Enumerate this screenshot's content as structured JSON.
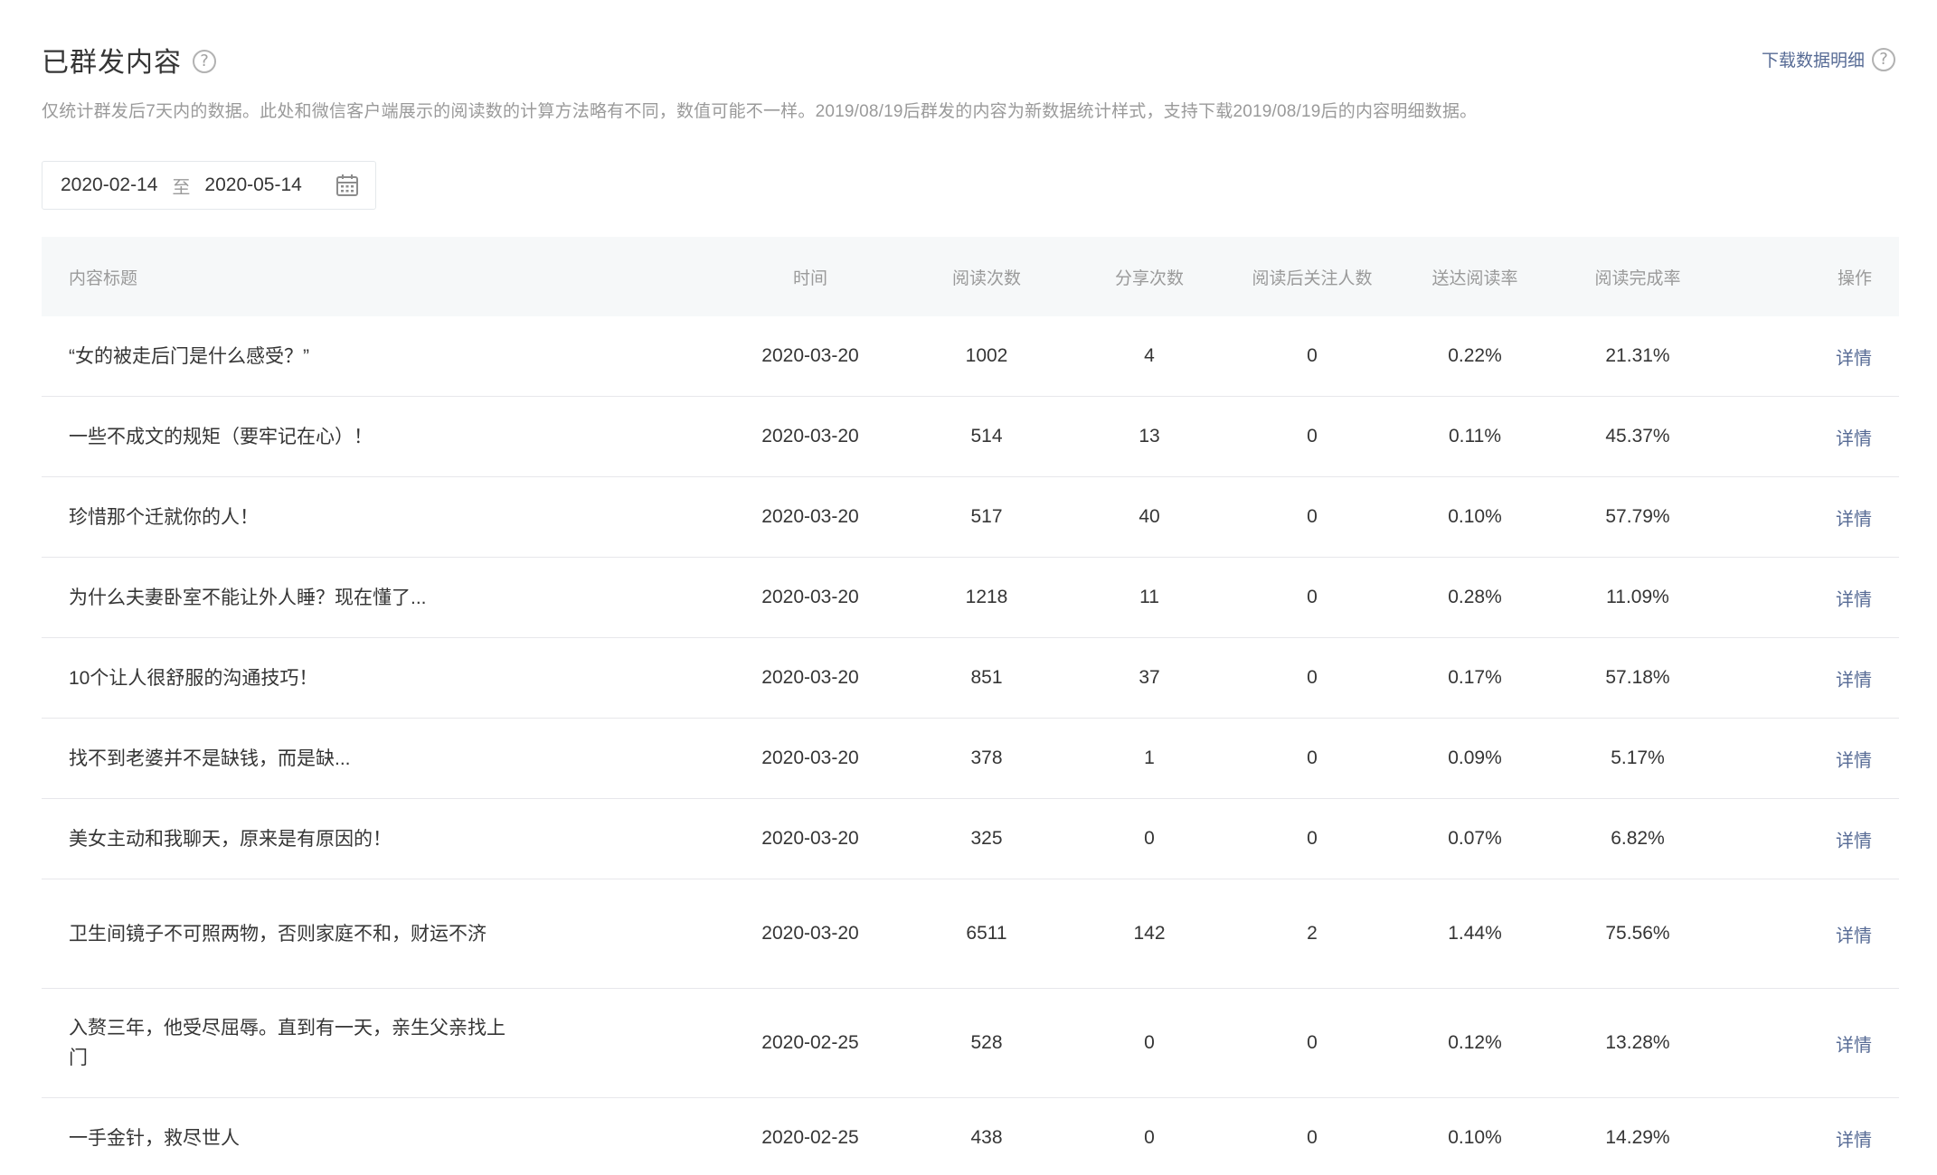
{
  "header": {
    "title": "已群发内容",
    "download_label": "下载数据明细",
    "description": "仅统计群发后7天内的数据。此处和微信客户端展示的阅读数的计算方法略有不同，数值可能不一样。2019/08/19后群发的内容为新数据统计样式，支持下载2019/08/19后的内容明细数据。"
  },
  "date_range": {
    "start": "2020-02-14",
    "separator": "至",
    "end": "2020-05-14"
  },
  "table": {
    "columns": {
      "title": "内容标题",
      "time": "时间",
      "reads": "阅读次数",
      "shares": "分享次数",
      "follows": "阅读后关注人数",
      "delivery_rate": "送达阅读率",
      "completion_rate": "阅读完成率",
      "action": "操作"
    },
    "rows": [
      {
        "title": "“女的被走后门是什么感受？”",
        "time": "2020-03-20",
        "reads": "1002",
        "shares": "4",
        "follows": "0",
        "delivery_rate": "0.22%",
        "completion_rate": "21.31%",
        "action": "详情"
      },
      {
        "title": "一些不成文的规矩（要牢记在心）！",
        "time": "2020-03-20",
        "reads": "514",
        "shares": "13",
        "follows": "0",
        "delivery_rate": "0.11%",
        "completion_rate": "45.37%",
        "action": "详情"
      },
      {
        "title": "珍惜那个迁就你的人！",
        "time": "2020-03-20",
        "reads": "517",
        "shares": "40",
        "follows": "0",
        "delivery_rate": "0.10%",
        "completion_rate": "57.79%",
        "action": "详情"
      },
      {
        "title": "为什么夫妻卧室不能让外人睡？现在懂了...",
        "time": "2020-03-20",
        "reads": "1218",
        "shares": "11",
        "follows": "0",
        "delivery_rate": "0.28%",
        "completion_rate": "11.09%",
        "action": "详情"
      },
      {
        "title": "10个让人很舒服的沟通技巧！",
        "time": "2020-03-20",
        "reads": "851",
        "shares": "37",
        "follows": "0",
        "delivery_rate": "0.17%",
        "completion_rate": "57.18%",
        "action": "详情"
      },
      {
        "title": "找不到老婆并不是缺钱，而是缺...",
        "time": "2020-03-20",
        "reads": "378",
        "shares": "1",
        "follows": "0",
        "delivery_rate": "0.09%",
        "completion_rate": "5.17%",
        "action": "详情"
      },
      {
        "title": "美女主动和我聊天，原来是有原因的！",
        "time": "2020-03-20",
        "reads": "325",
        "shares": "0",
        "follows": "0",
        "delivery_rate": "0.07%",
        "completion_rate": "6.82%",
        "action": "详情"
      },
      {
        "title": "卫生间镜子不可照两物，否则家庭不和，财运不济",
        "time": "2020-03-20",
        "reads": "6511",
        "shares": "142",
        "follows": "2",
        "delivery_rate": "1.44%",
        "completion_rate": "75.56%",
        "action": "详情"
      },
      {
        "title": "入赘三年，他受尽屈辱。直到有一天，亲生父亲找上门",
        "time": "2020-02-25",
        "reads": "528",
        "shares": "0",
        "follows": "0",
        "delivery_rate": "0.12%",
        "completion_rate": "13.28%",
        "action": "详情"
      },
      {
        "title": "一手金针，救尽世人",
        "time": "2020-02-25",
        "reads": "438",
        "shares": "0",
        "follows": "0",
        "delivery_rate": "0.10%",
        "completion_rate": "14.29%",
        "action": "详情"
      }
    ]
  },
  "icons": {
    "help": "question-mark-icon",
    "calendar": "calendar-icon",
    "help_glyph": "?"
  },
  "colors": {
    "link": "#576b95",
    "header_bg": "#f6f8f9",
    "muted_text": "#9a9a9a"
  }
}
